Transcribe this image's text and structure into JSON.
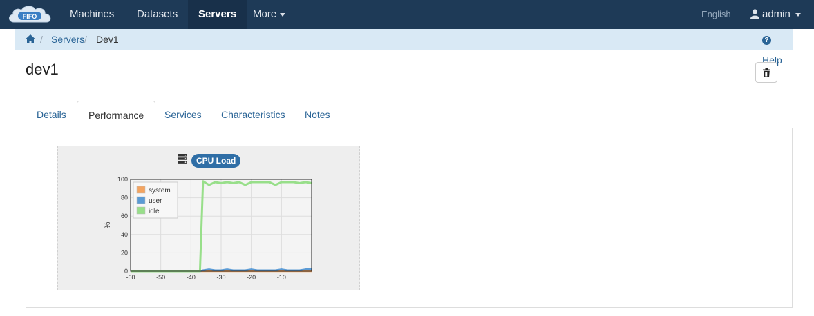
{
  "navbar": {
    "logo_text": "FIFO",
    "items": [
      {
        "label": "Machines",
        "active": false
      },
      {
        "label": "Datasets",
        "active": false
      },
      {
        "label": "Servers",
        "active": true
      },
      {
        "label": "More",
        "active": false
      }
    ],
    "language": "English",
    "user": "admin",
    "colors": {
      "bar": "#1e3a57",
      "active": "#18304a"
    }
  },
  "breadcrumb": {
    "home_icon": "home-icon",
    "items": [
      "Servers",
      "Dev1"
    ],
    "help": "Help"
  },
  "page": {
    "title": "dev1",
    "delete_icon": "trash-icon"
  },
  "tabs": [
    "Details",
    "Performance",
    "Services",
    "Characteristics",
    "Notes"
  ],
  "active_tab": "Performance",
  "widget": {
    "icon": "server-icon",
    "title": "CPU Load"
  },
  "chart_data": {
    "type": "line",
    "ylabel": "%",
    "xlim": [
      -60,
      0
    ],
    "ylim": [
      0,
      100
    ],
    "x_ticks": [
      -60,
      -50,
      -40,
      -30,
      -20,
      -10
    ],
    "y_ticks": [
      0,
      20,
      40,
      60,
      80,
      100
    ],
    "legend_position": "top-left",
    "grid": true,
    "series": [
      {
        "name": "system",
        "color": "#f4a460",
        "x": [
          -60,
          -50,
          -40,
          -37,
          -36,
          -30,
          -20,
          -10,
          0
        ],
        "y": [
          0,
          0,
          0,
          0,
          0,
          0,
          0,
          0,
          0
        ]
      },
      {
        "name": "user",
        "color": "#5b9bd5",
        "x": [
          -60,
          -50,
          -40,
          -37,
          -36,
          -34,
          -32,
          -30,
          -28,
          -26,
          -24,
          -22,
          -20,
          -18,
          -16,
          -14,
          -12,
          -10,
          -8,
          -6,
          -4,
          -2,
          0
        ],
        "y": [
          0,
          0,
          0,
          0,
          1,
          2,
          1,
          1,
          2,
          1,
          1,
          1,
          2,
          1,
          1,
          1,
          1,
          2,
          1,
          1,
          1,
          2,
          2
        ]
      },
      {
        "name": "idle",
        "color": "#98df8a",
        "x": [
          -60,
          -50,
          -40,
          -37,
          -36,
          -34,
          -32,
          -30,
          -28,
          -26,
          -24,
          -22,
          -20,
          -18,
          -16,
          -14,
          -12,
          -10,
          -8,
          -6,
          -4,
          -2,
          0
        ],
        "y": [
          0,
          0,
          0,
          0,
          98,
          94,
          97,
          96,
          97,
          96,
          97,
          94,
          97,
          97,
          97,
          97,
          94,
          97,
          97,
          97,
          96,
          97,
          96
        ]
      }
    ]
  }
}
